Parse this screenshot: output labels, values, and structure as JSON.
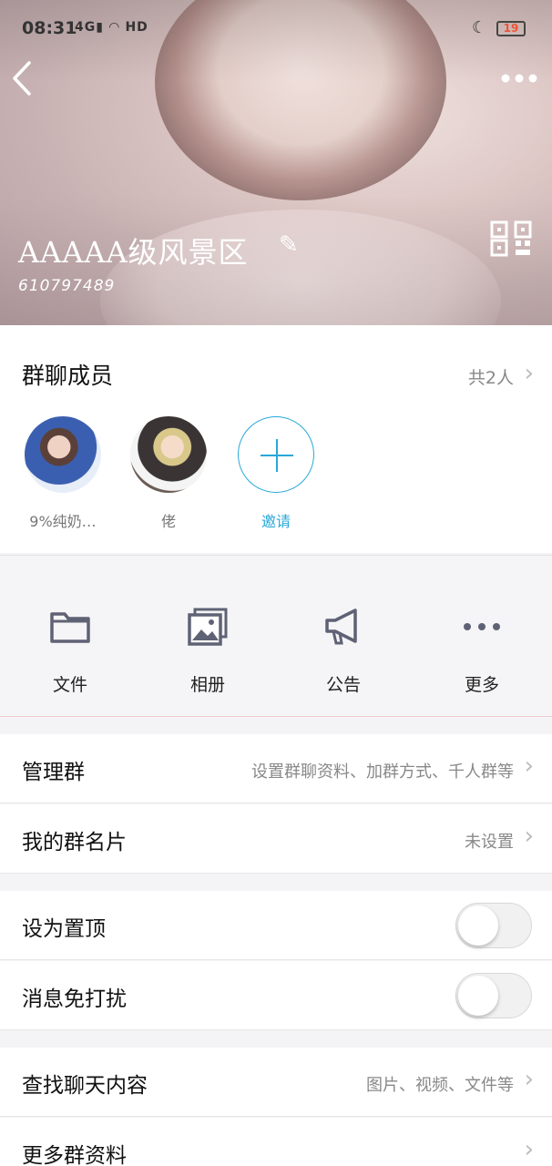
{
  "status_bar": {
    "time": "08:31",
    "signal": "4G",
    "hd": "HD",
    "battery": "19"
  },
  "header": {
    "group_name": "AAAAA级风景区",
    "group_id": "610797489",
    "back_icon": "chevron-left-icon",
    "more_icon": "more-horizontal-icon",
    "edit_icon": "pencil-icon",
    "qr_icon": "qr-code-icon"
  },
  "members": {
    "title": "群聊成员",
    "count": "共2人",
    "list": [
      {
        "name": "9%纯奶…"
      },
      {
        "name": "佬"
      }
    ],
    "invite_label": "邀请"
  },
  "actions": [
    {
      "label": "文件",
      "icon": "folder-icon"
    },
    {
      "label": "相册",
      "icon": "photo-album-icon"
    },
    {
      "label": "公告",
      "icon": "megaphone-icon"
    },
    {
      "label": "更多",
      "icon": "more-icon"
    }
  ],
  "rows": {
    "manage": {
      "label": "管理群",
      "value": "设置群聊资料、加群方式、千人群等"
    },
    "card": {
      "label": "我的群名片",
      "value": "未设置"
    },
    "pin": {
      "label": "设为置顶",
      "on": false
    },
    "mute": {
      "label": "消息免打扰",
      "on": false
    },
    "search": {
      "label": "查找聊天内容",
      "value": "图片、视频、文件等"
    },
    "more_info": {
      "label": "更多群资料"
    }
  },
  "colors": {
    "accent": "#28a8d8",
    "icon_gray": "#5f6275"
  }
}
